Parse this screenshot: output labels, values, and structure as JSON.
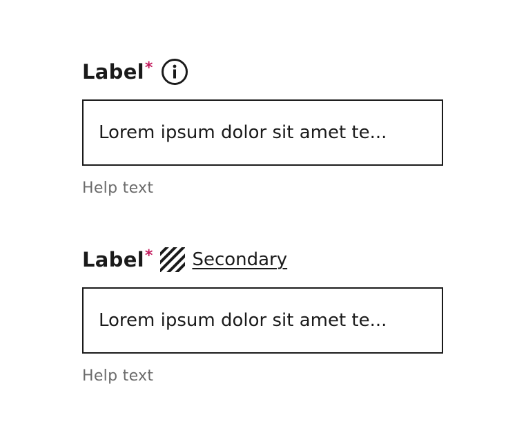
{
  "fields": [
    {
      "label": "Label",
      "required_mark": "*",
      "label_icon": "info-circle-icon",
      "input_value": "Lorem ipsum dolor sit amet te...",
      "help_text": "Help text"
    },
    {
      "label": "Label",
      "required_mark": "*",
      "label_icon": "diagonal-stripes-icon",
      "secondary_link": "Secondary",
      "input_value": "Lorem ipsum dolor sit amet te...",
      "help_text": "Help text"
    }
  ],
  "colors": {
    "text": "#1a1a1a",
    "required": "#c2185b",
    "help": "#6b6b6b",
    "border": "#1a1a1a"
  }
}
